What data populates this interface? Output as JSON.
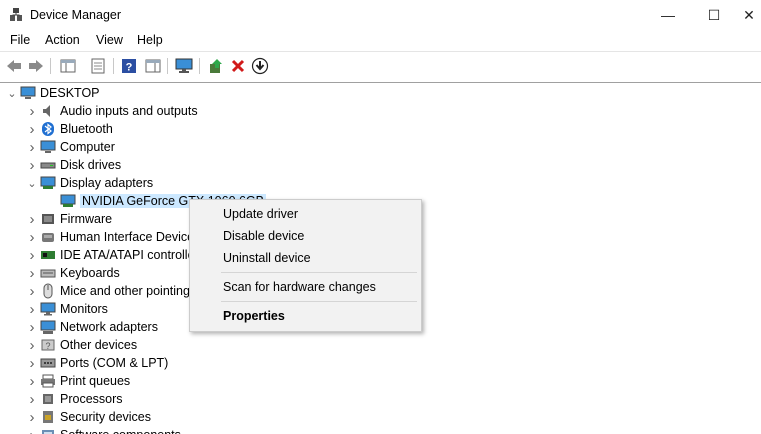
{
  "window": {
    "title": "Device Manager",
    "minimize_glyph": "—",
    "maximize_glyph": "☐",
    "close_glyph": "✕"
  },
  "menu": [
    "File",
    "Action",
    "View",
    "Help"
  ],
  "toolbar": {
    "icons": [
      "back-icon",
      "forward-icon",
      "show-hide-console-tree-icon",
      "properties-icon",
      "help-icon",
      "action-pane-icon",
      "monitor-icon",
      "update-driver-icon",
      "uninstall-icon",
      "download-icon"
    ]
  },
  "tree": {
    "root": "DESKTOP",
    "categories": [
      {
        "label": "Audio inputs and outputs",
        "icon": "speaker-icon"
      },
      {
        "label": "Bluetooth",
        "icon": "bluetooth-icon"
      },
      {
        "label": "Computer",
        "icon": "computer-icon"
      },
      {
        "label": "Disk drives",
        "icon": "disk-drive-icon"
      },
      {
        "label": "Display adapters",
        "icon": "display-adapter-icon",
        "expanded": true
      },
      {
        "label": "Firmware",
        "icon": "firmware-icon"
      },
      {
        "label": "Human Interface Device",
        "icon": "hid-icon"
      },
      {
        "label": "IDE ATA/ATAPI controlle",
        "icon": "ide-controller-icon"
      },
      {
        "label": "Keyboards",
        "icon": "keyboard-icon"
      },
      {
        "label": "Mice and other pointing",
        "icon": "mouse-icon"
      },
      {
        "label": "Monitors",
        "icon": "monitor-icon"
      },
      {
        "label": "Network adapters",
        "icon": "network-adapter-icon"
      },
      {
        "label": "Other devices",
        "icon": "other-devices-icon"
      },
      {
        "label": "Ports (COM & LPT)",
        "icon": "port-icon"
      },
      {
        "label": "Print queues",
        "icon": "printer-icon"
      },
      {
        "label": "Processors",
        "icon": "processor-icon"
      },
      {
        "label": "Security devices",
        "icon": "security-device-icon"
      },
      {
        "label": "Software components",
        "icon": "software-component-icon"
      }
    ],
    "child_device": "NVIDIA GeForce GTX 1060 6GB"
  },
  "context_menu": {
    "items": [
      "Update driver",
      "Disable device",
      "Uninstall device",
      "Scan for hardware changes",
      "Properties"
    ]
  },
  "colors": {
    "selection": "#cce8ff",
    "menu_bg": "#f2f2f2"
  }
}
